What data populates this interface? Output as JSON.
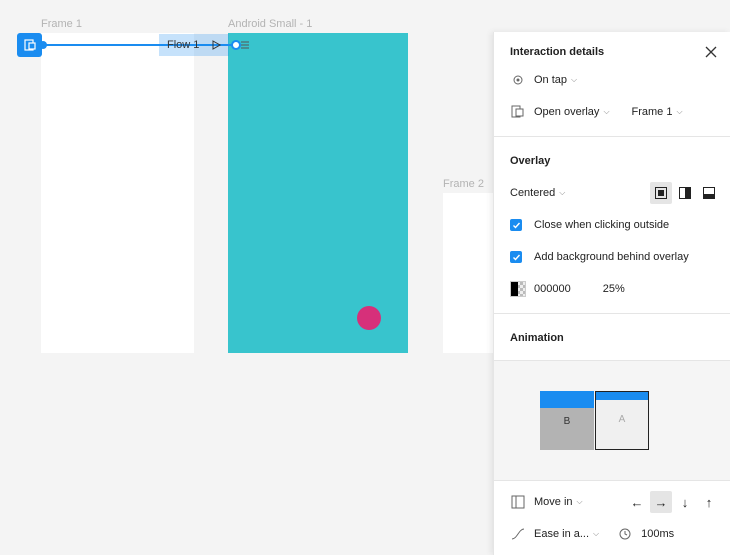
{
  "canvas": {
    "frame1_label": "Frame 1",
    "android_label": "Android Small - 1",
    "frame2_label": "Frame 2",
    "flow_label": "Flow 1"
  },
  "panel": {
    "title": "Interaction details",
    "trigger": "On tap",
    "action": "Open overlay",
    "destination": "Frame 1",
    "overlay_title": "Overlay",
    "position": "Centered",
    "close_outside_label": "Close when clicking outside",
    "close_outside_checked": true,
    "add_background_label": "Add background behind overlay",
    "add_background_checked": true,
    "bg_color": "000000",
    "bg_opacity": "25%",
    "animation_title": "Animation",
    "preview_b": "B",
    "preview_a": "A",
    "transition": "Move in",
    "easing": "Ease in a...",
    "duration": "100ms",
    "directions": [
      "←",
      "→",
      "↓",
      "↑"
    ],
    "active_direction": "→"
  },
  "colors": {
    "accent": "#1a8cf0",
    "teal": "#38c4cd",
    "pink": "#d6307a"
  }
}
